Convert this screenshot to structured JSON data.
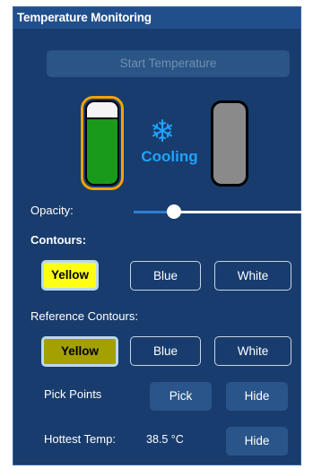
{
  "window": {
    "title": "Temperature Monitoring"
  },
  "start_button": {
    "label": "Start Temperature",
    "enabled": false
  },
  "status": {
    "label": "Cooling",
    "icon": "snowflake-icon",
    "color": "#1fa3ff"
  },
  "opacity": {
    "label": "Opacity:",
    "value": 0.23
  },
  "contours": {
    "label": "Contours:",
    "options": [
      "Yellow",
      "Blue",
      "White"
    ],
    "selected": "Yellow"
  },
  "reference_contours": {
    "label": "Reference Contours:",
    "options": [
      "Yellow",
      "Blue",
      "White"
    ],
    "selected": "Yellow"
  },
  "pick_points": {
    "label": "Pick Points",
    "pick_label": "Pick",
    "hide_label": "Hide"
  },
  "hottest": {
    "label": "Hottest Temp:",
    "value": "38.5 °C",
    "hide_label": "Hide"
  },
  "colors": {
    "panel_bg": "#183c6d",
    "title_bg": "#214f8b",
    "contour_yellow": "#ffff14",
    "reference_yellow": "#a3a000",
    "cylinder_highlight": "#f5a300",
    "active_fill": "#1a9a1a",
    "inactive_fill": "#8a8a8a"
  }
}
